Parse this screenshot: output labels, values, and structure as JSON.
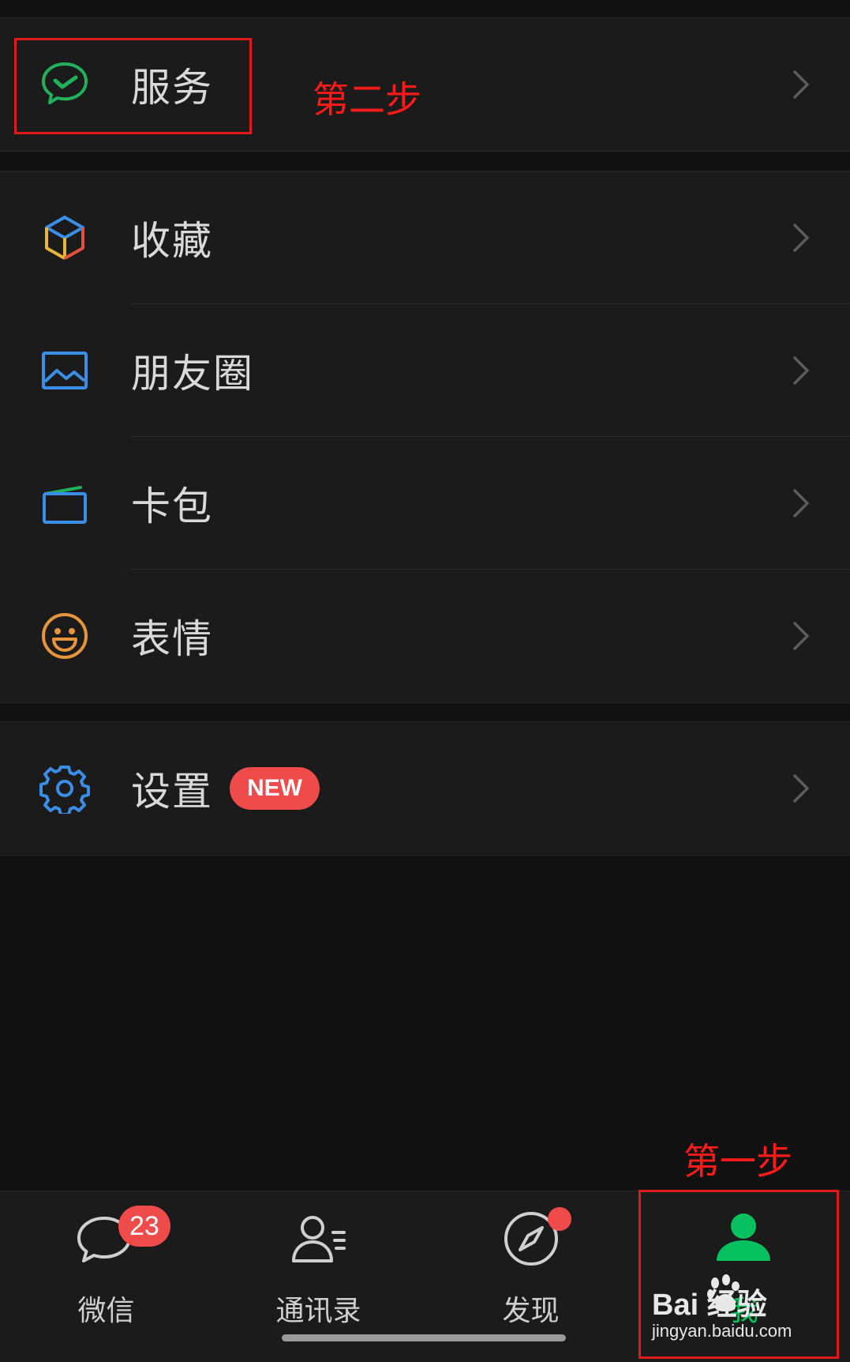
{
  "menu": {
    "service": {
      "label": "服务"
    },
    "favorites": {
      "label": "收藏"
    },
    "moments": {
      "label": "朋友圈"
    },
    "cards": {
      "label": "卡包"
    },
    "stickers": {
      "label": "表情"
    },
    "settings": {
      "label": "设置",
      "badge": "NEW"
    }
  },
  "annotations": {
    "step_two": "第二步",
    "step_one": "第一步"
  },
  "tabbar": {
    "chats": {
      "label": "微信",
      "badge_count": "23"
    },
    "contacts": {
      "label": "通讯录"
    },
    "discover": {
      "label": "发现"
    },
    "me": {
      "label": "我"
    }
  },
  "watermark": {
    "brand": "Bai 经验",
    "url": "jingyan.baidu.com"
  },
  "colors": {
    "background": "#111111",
    "group": "#1b1b1b",
    "accent_green": "#07c160",
    "badge_red": "#f04b4b",
    "annotation_red": "#ff1a1a"
  },
  "icons": [
    "wechat-pay-icon",
    "cube-icon",
    "image-icon",
    "wallet-icon",
    "smiley-icon",
    "gear-icon",
    "chat-bubble-icon",
    "contacts-icon",
    "compass-icon",
    "person-icon",
    "chevron-right-icon"
  ]
}
